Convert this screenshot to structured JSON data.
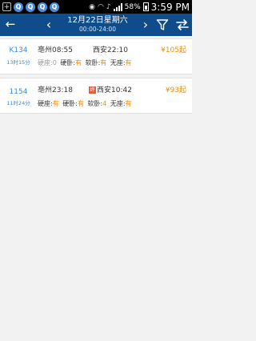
{
  "status_bar": {
    "battery": "58%",
    "time": "3:59 PM"
  },
  "header": {
    "date": "12月22日星期六",
    "time_range": "00:00-24:00"
  },
  "trains": [
    {
      "number": "K134",
      "duration": "13时15分",
      "depart": "亳州08:55",
      "arrive": "西安22:10",
      "terminal_badge": "",
      "price": "¥105起",
      "dim_first_seat": true,
      "seats": [
        {
          "label": "硬座:",
          "value": "0"
        },
        {
          "label": "硬卧:",
          "value": "有"
        },
        {
          "label": "软卧:",
          "value": "有"
        },
        {
          "label": "无座:",
          "value": "有"
        }
      ]
    },
    {
      "number": "1154",
      "duration": "11时24分",
      "depart": "亳州23:18",
      "arrive": "西安10:42",
      "terminal_badge": "终",
      "price": "¥93起",
      "dim_first_seat": false,
      "seats": [
        {
          "label": "硬座:",
          "value": "有"
        },
        {
          "label": "硬卧:",
          "value": "有"
        },
        {
          "label": "软卧:",
          "value": "4"
        },
        {
          "label": "无座:",
          "value": "有"
        }
      ]
    }
  ]
}
